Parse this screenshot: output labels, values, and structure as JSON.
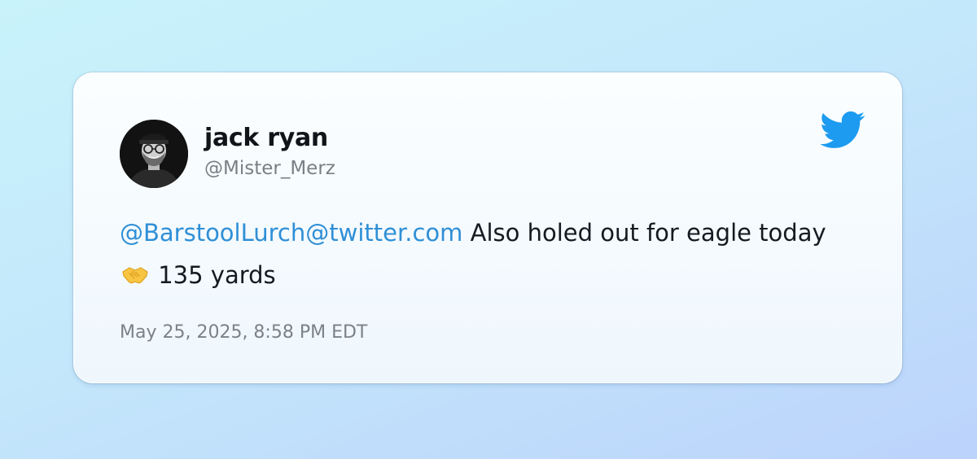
{
  "author": {
    "name": "jack ryan",
    "handle": "@Mister_Merz",
    "avatar_icon": "person-avatar-icon"
  },
  "tweet": {
    "mention": "@BarstoolLurch@twitter.com",
    "text_before_emoji": " Also holed out for eagle today",
    "emoji": "handshake-emoji",
    "text_after_emoji": "135 yards",
    "timestamp": "May 25, 2025, 8:58 PM EDT"
  },
  "brand": {
    "logo": "twitter-bird-icon",
    "twitter_blue": "#1d9bf0",
    "mention_color": "#2f8fd6"
  }
}
